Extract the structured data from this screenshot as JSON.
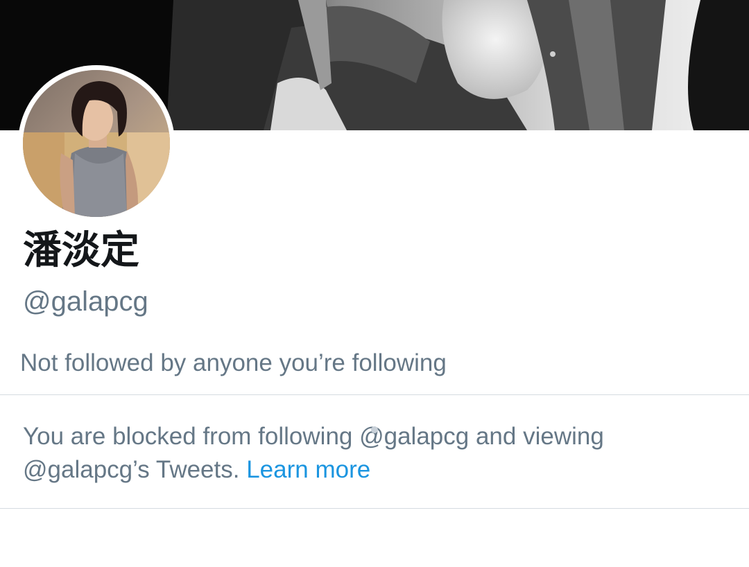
{
  "profile": {
    "display_name": "潘淡定",
    "handle": "@galapcg",
    "followers_note": "Not followed by anyone you’re following",
    "banner_icon": "banner-photo",
    "avatar_icon": "avatar-photo"
  },
  "blocked": {
    "line1": "You are blocked from following @galapcg and viewing",
    "line2_prefix": "@galapcg’s Tweets.",
    "learn_more": "Learn more"
  },
  "colors": {
    "name": "#14171a",
    "secondary_text": "#657786",
    "link": "#1b95e0",
    "divider": "#d5dbe0"
  }
}
